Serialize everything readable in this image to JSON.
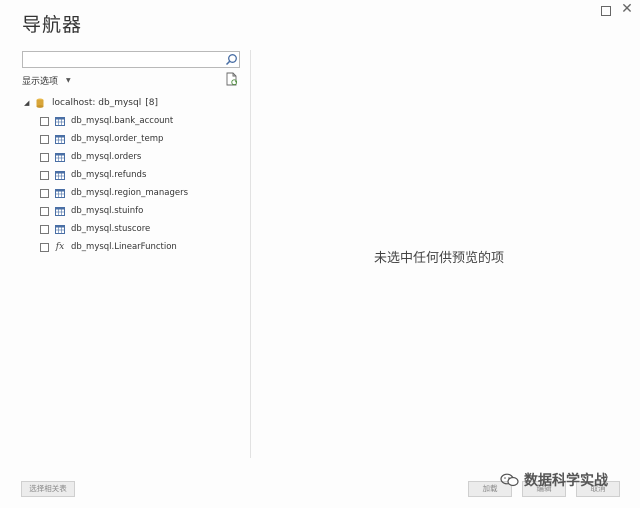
{
  "window": {
    "title": "导航器"
  },
  "search": {
    "value": "",
    "placeholder": ""
  },
  "left_pane": {
    "display_options_label": "显示选项",
    "root": {
      "label": "localhost: db_mysql",
      "count": "[8]"
    },
    "items": [
      {
        "label": "db_mysql.bank_account",
        "icon": "table-icon"
      },
      {
        "label": "db_mysql.order_temp",
        "icon": "table-icon"
      },
      {
        "label": "db_mysql.orders",
        "icon": "table-icon"
      },
      {
        "label": "db_mysql.refunds",
        "icon": "table-icon"
      },
      {
        "label": "db_mysql.region_managers",
        "icon": "table-icon"
      },
      {
        "label": "db_mysql.stuinfo",
        "icon": "table-icon"
      },
      {
        "label": "db_mysql.stuscore",
        "icon": "table-icon"
      },
      {
        "label": "db_mysql.LinearFunction",
        "icon": "function-icon",
        "icon_text": "fx"
      }
    ]
  },
  "preview": {
    "empty_message": "未选中任何供预览的项"
  },
  "footer": {
    "select_related_label": "选择相关表",
    "load_label": "加载",
    "edit_label": "编辑",
    "cancel_label": "取消"
  },
  "watermark": {
    "text": "数据科学实战"
  },
  "colors": {
    "table_icon": "#4a6fa5",
    "db_icon": "#d9a63a"
  }
}
